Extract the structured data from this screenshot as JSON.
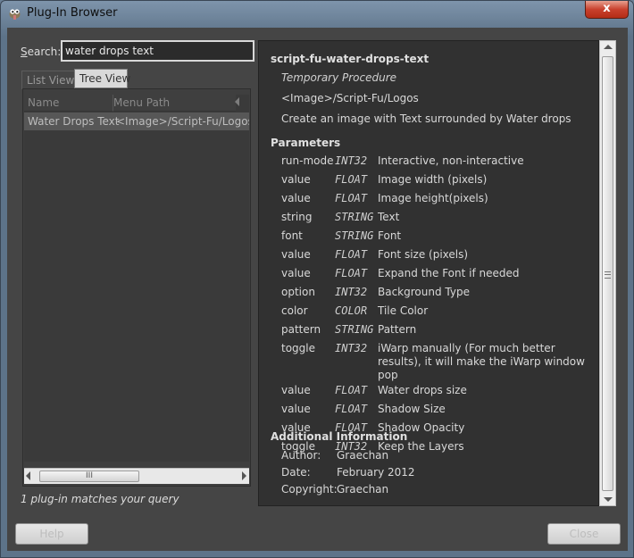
{
  "window": {
    "title": "Plug-In Browser",
    "close_glyph": "x"
  },
  "search": {
    "label_prefix": "S",
    "label_rest": "earch:",
    "value": "water drops text"
  },
  "tabs": [
    {
      "label": "List View"
    },
    {
      "label": "Tree View"
    }
  ],
  "list": {
    "columns": [
      "Name",
      "Menu Path"
    ],
    "rows": [
      {
        "name": "Water Drops Text",
        "path": "<Image>/Script-Fu/Logos"
      }
    ],
    "scroll_grip": "III"
  },
  "match_text": "1 plug-in matches your query",
  "detail": {
    "title": "script-fu-water-drops-text",
    "proc_type": "Temporary Procedure",
    "menu_path": "<Image>/Script-Fu/Logos",
    "blurb": "Create an image with Text surrounded by Water drops",
    "params_heading": "Parameters",
    "params": [
      {
        "name": "run-mode",
        "type": "INT32",
        "desc": "Interactive, non-interactive"
      },
      {
        "name": "value",
        "type": "FLOAT",
        "desc": "Image width (pixels)"
      },
      {
        "name": "value",
        "type": "FLOAT",
        "desc": "Image height(pixels)"
      },
      {
        "name": "string",
        "type": "STRING",
        "desc": "Text"
      },
      {
        "name": "font",
        "type": "STRING",
        "desc": "Font"
      },
      {
        "name": "value",
        "type": "FLOAT",
        "desc": "Font size (pixels)"
      },
      {
        "name": "value",
        "type": "FLOAT",
        "desc": "Expand the Font if needed"
      },
      {
        "name": "option",
        "type": "INT32",
        "desc": "Background Type"
      },
      {
        "name": "color",
        "type": "COLOR",
        "desc": "Tile Color"
      },
      {
        "name": "pattern",
        "type": "STRING",
        "desc": "Pattern"
      },
      {
        "name": "toggle",
        "type": "INT32",
        "desc": "iWarp manually (For much better results), it will make the iWarp window pop"
      },
      {
        "name": "value",
        "type": "FLOAT",
        "desc": "Water drops size"
      },
      {
        "name": "value",
        "type": "FLOAT",
        "desc": "Shadow Size"
      },
      {
        "name": "value",
        "type": "FLOAT",
        "desc": "Shadow Opacity"
      },
      {
        "name": "toggle",
        "type": "INT32",
        "desc": "Keep the Layers"
      }
    ],
    "additional_heading": "Additional Information",
    "info": [
      {
        "label": "Author:",
        "value": "Graechan"
      },
      {
        "label": "Date:",
        "value": "February 2012"
      },
      {
        "label": "Copyright:",
        "value": "Graechan"
      }
    ]
  },
  "buttons": {
    "help": "Help",
    "close": "Close"
  }
}
